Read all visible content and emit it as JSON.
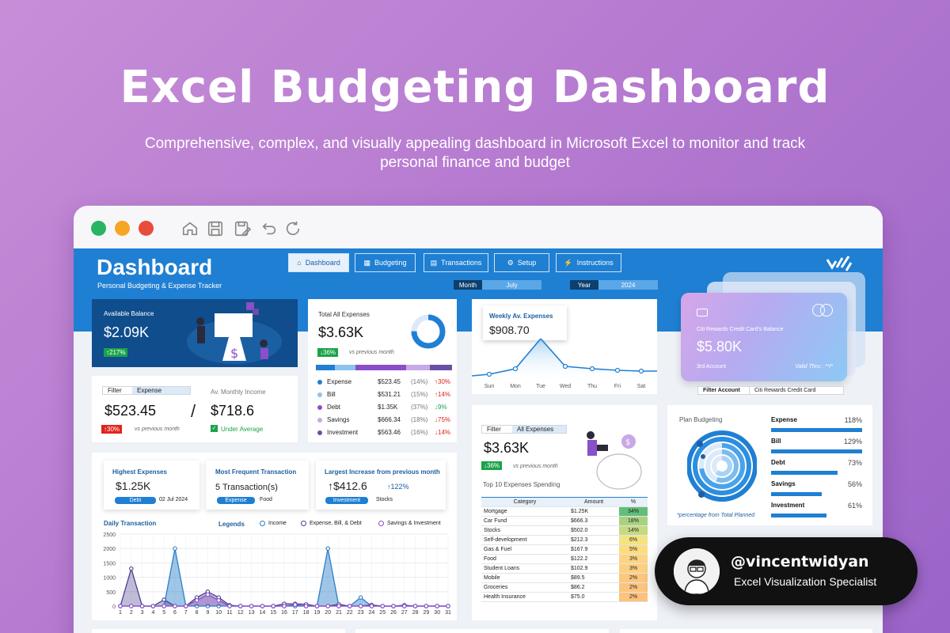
{
  "hero": {
    "title": "Excel Budgeting Dashboard",
    "subtitle": "Comprehensive, complex, and visually appealing dashboard in Microsoft Excel to monitor and track personal finance and budget"
  },
  "window": {
    "dots": [
      "#28b463",
      "#f5a623",
      "#e74c3c"
    ],
    "toolbar_icons": [
      "home-icon",
      "save-icon",
      "edit-save-icon",
      "undo-icon",
      "refresh-icon"
    ]
  },
  "dashboard": {
    "title": "Dashboard",
    "subtitle": "Personal Budgeting & Expense Tracker",
    "nav": [
      {
        "label": "Dashboard",
        "icon": "home-icon",
        "active": true
      },
      {
        "label": "Budgeting",
        "icon": "grid-icon",
        "active": false
      },
      {
        "label": "Transactions",
        "icon": "document-icon",
        "active": false
      },
      {
        "label": "Setup",
        "icon": "gear-icon",
        "active": false
      },
      {
        "label": "Instructions",
        "icon": "pulse-icon",
        "active": false
      }
    ],
    "month_label": "Month",
    "month_value": "July",
    "year_label": "Year",
    "year_value": "2024"
  },
  "balance": {
    "label": "Available Balance",
    "value": "$2.09K",
    "badge": "↑217%"
  },
  "expense_filter": {
    "filter_label": "Filter",
    "filter_value": "Expense",
    "value": "$523.45",
    "badge": "↑30%",
    "compare": "vs previous month",
    "divider": "/",
    "avg_label": "Av. Monthly Income",
    "avg_value": "$718.6",
    "avg_status": "Under Average"
  },
  "total_expenses": {
    "label": "Total All Expenses",
    "value": "$3.63K",
    "badge": "↓36%",
    "compare": "vs previous month",
    "bar_colors": [
      "#1f7fd3",
      "#8cc3ef",
      "#8a4fc9",
      "#c8a8e6",
      "#6a4fa6"
    ],
    "rows": [
      {
        "name": "Expense",
        "value": "$523.45",
        "pct": "(14%)",
        "change": "↑30%",
        "up": true,
        "color": "#1f7fd3"
      },
      {
        "name": "Bill",
        "value": "$531.21",
        "pct": "(15%)",
        "change": "↑14%",
        "up": true,
        "color": "#8cc3ef"
      },
      {
        "name": "Debt",
        "value": "$1.35K",
        "pct": "(37%)",
        "change": "↓9%",
        "up": false,
        "color": "#8a4fc9"
      },
      {
        "name": "Savings",
        "value": "$666.34",
        "pct": "(18%)",
        "change": "↓75%",
        "up": true,
        "color": "#c8a8e6"
      },
      {
        "name": "Investment",
        "value": "$563.46",
        "pct": "(16%)",
        "change": "↓14%",
        "up": true,
        "color": "#6a4fa6"
      }
    ]
  },
  "weekly": {
    "label": "Weekly Av. Expenses",
    "value": "$908.70",
    "days": [
      "Sun",
      "Mon",
      "Tue",
      "Wed",
      "Thu",
      "Fri",
      "Sat"
    ]
  },
  "credit_card": {
    "name": "Citi Rewards Credit Card's Balance",
    "value": "$5.80K",
    "account": "3rd Account",
    "valid": "Valid Thru : **/*",
    "filter_label": "Filter Account",
    "filter_value": "Citi Rewards Credit Card"
  },
  "top10": {
    "filter_label": "Filter",
    "filter_value": "All Expenses",
    "value": "$3.63K",
    "badge": "↓36%",
    "compare": "vs previous month",
    "title": "Top 10 Expenses Spending",
    "headers": [
      "Category",
      "Amount",
      "%"
    ],
    "rows": [
      {
        "category": "Mortgage",
        "amount": "$1.25K",
        "pct": "34%",
        "color": "#63be7b"
      },
      {
        "category": "Car Fund",
        "amount": "$666.3",
        "pct": "18%",
        "color": "#a9d27f"
      },
      {
        "category": "Stocks",
        "amount": "$502.0",
        "pct": "14%",
        "color": "#c5da81"
      },
      {
        "category": "Self-development",
        "amount": "$212.3",
        "pct": "6%",
        "color": "#f3e383"
      },
      {
        "category": "Gas & Fuel",
        "amount": "$167.9",
        "pct": "5%",
        "color": "#fddc7f"
      },
      {
        "category": "Food",
        "amount": "$122.2",
        "pct": "3%",
        "color": "#fed47f"
      },
      {
        "category": "Student Loans",
        "amount": "$102.9",
        "pct": "3%",
        "color": "#fed07e"
      },
      {
        "category": "Mobile",
        "amount": "$89.5",
        "pct": "2%",
        "color": "#fdc77d"
      },
      {
        "category": "Groceries",
        "amount": "$86.2",
        "pct": "2%",
        "color": "#fdc47c"
      },
      {
        "category": "Health Insurance",
        "amount": "$75.0",
        "pct": "2%",
        "color": "#fdc27b"
      }
    ]
  },
  "plan": {
    "title": "Plan Budgeting",
    "note": "*percentage from Total Planned",
    "rows": [
      {
        "name": "Expense",
        "pct": "118%",
        "fill": 1.0
      },
      {
        "name": "Bill",
        "pct": "129%",
        "fill": 1.0
      },
      {
        "name": "Debt",
        "pct": "73%",
        "fill": 0.73
      },
      {
        "name": "Savings",
        "pct": "56%",
        "fill": 0.56
      },
      {
        "name": "Investment",
        "pct": "61%",
        "fill": 0.61
      }
    ]
  },
  "stats": {
    "highest": {
      "title": "Highest Expenses",
      "value": "$1.25K",
      "tag": "Debt",
      "date": "02 Jul 2024"
    },
    "frequent": {
      "title": "Most Frequent Transaction",
      "value": "5 Transaction(s)",
      "tag": "Expense",
      "extra": "Food"
    },
    "increase": {
      "title": "Largest Increase from previous month",
      "value": "↑$412.6",
      "change": "↑122%",
      "tag": "Investment",
      "extra": "Stocks"
    }
  },
  "daily": {
    "title": "Daily Transaction",
    "legend_title": "Legends",
    "legend": [
      "Income",
      "Expense, Bill, & Debt",
      "Savings & Investment"
    ]
  },
  "chart_data": {
    "type": "area",
    "title": "Daily Transaction",
    "x": [
      1,
      2,
      3,
      4,
      5,
      6,
      7,
      8,
      9,
      10,
      11,
      12,
      13,
      14,
      15,
      16,
      17,
      18,
      19,
      20,
      21,
      22,
      23,
      24,
      25,
      26,
      27,
      28,
      29,
      30,
      31
    ],
    "ylim": [
      0,
      2500
    ],
    "yticks": [
      0,
      500,
      1000,
      1500,
      2000,
      2500
    ],
    "series": [
      {
        "name": "Income",
        "color": "#2b7fc9",
        "values": [
          0,
          0,
          0,
          0,
          0,
          2000,
          0,
          0,
          0,
          0,
          0,
          0,
          0,
          0,
          0,
          0,
          0,
          0,
          0,
          2000,
          0,
          0,
          300,
          0,
          0,
          0,
          0,
          0,
          0,
          0,
          0
        ]
      },
      {
        "name": "Expense, Bill, & Debt",
        "color": "#4a3f8f",
        "values": [
          0,
          1300,
          0,
          0,
          220,
          0,
          0,
          300,
          500,
          300,
          30,
          0,
          0,
          0,
          0,
          80,
          80,
          60,
          0,
          0,
          60,
          0,
          0,
          40,
          0,
          0,
          30,
          0,
          0,
          0,
          0
        ]
      },
      {
        "name": "Savings & Investment",
        "color": "#8a4fc9",
        "values": [
          0,
          0,
          0,
          0,
          0,
          0,
          0,
          200,
          400,
          200,
          0,
          0,
          0,
          0,
          0,
          0,
          50,
          0,
          0,
          0,
          0,
          0,
          0,
          0,
          0,
          0,
          0,
          0,
          0,
          0,
          0
        ]
      }
    ]
  },
  "profile": {
    "handle": "@vincentwidyan",
    "role": "Excel Visualization Specialist"
  }
}
